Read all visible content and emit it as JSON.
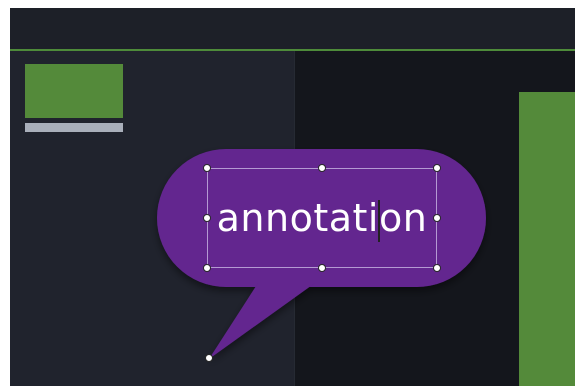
{
  "annotation": {
    "text_before_caret": "annotati",
    "text_after_caret": "on",
    "fill_color": "#63258f",
    "text_color": "#ffffff"
  },
  "canvas": {
    "accent_color": "#4e8b3a",
    "background_color": "#14161c",
    "panel_color": "#20232d"
  }
}
